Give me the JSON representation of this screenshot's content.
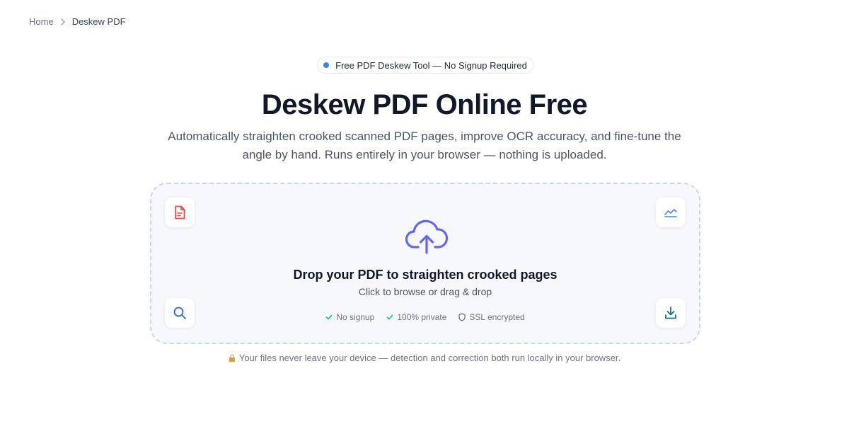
{
  "breadcrumb": {
    "home": "Home",
    "current": "Deskew PDF"
  },
  "badge": {
    "text": "Free PDF Deskew Tool — No Signup Required",
    "dot_color": "#3b82f6"
  },
  "hero": {
    "title": "Deskew PDF Online Free",
    "subtitle": "Automatically straighten crooked scanned PDF pages, improve OCR accuracy, and fine-tune the angle by hand. Runs entirely in your browser — nothing is uploaded."
  },
  "dropzone": {
    "title": "Drop your PDF to straighten crooked pages",
    "subtitle": "Click to browse or drag & drop",
    "icons": [
      "pdf-file-icon",
      "chart-line-icon",
      "search-icon",
      "download-icon",
      "upload-cloud-icon"
    ],
    "features": [
      {
        "icon": "check-icon",
        "label": "No signup"
      },
      {
        "icon": "check-icon",
        "label": "100% private"
      },
      {
        "icon": "shield-icon",
        "label": "SSL encrypted"
      }
    ]
  },
  "privacy_note": {
    "icon": "lock-icon",
    "text": "Your files never leave your device — detection and correction both run locally in your browser."
  },
  "colors": {
    "accent": "#3b82f6",
    "upload_icon": "#6366f1",
    "pdf_icon": "#ef4444",
    "download_icon": "#0f766e",
    "check": "#10b981"
  }
}
